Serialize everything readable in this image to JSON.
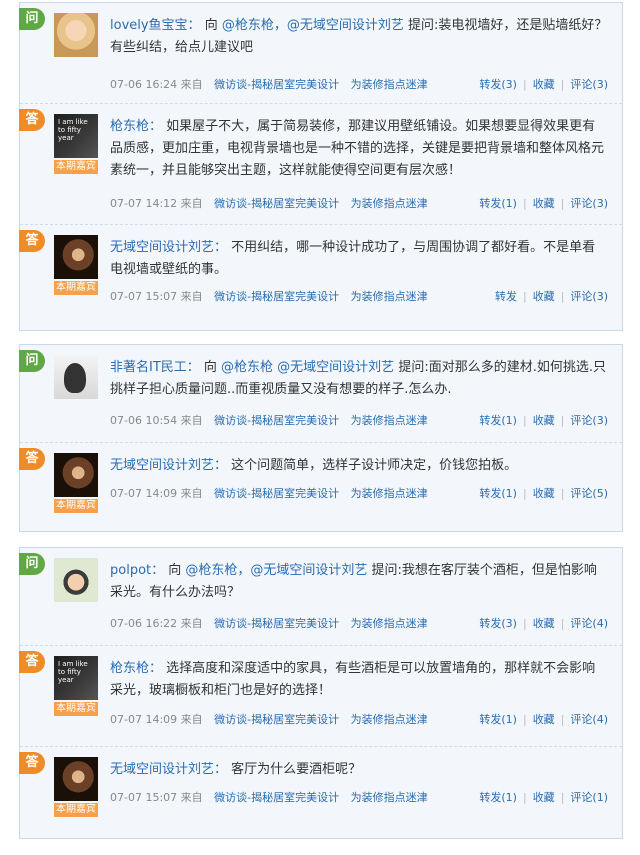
{
  "threads": [
    {
      "question": {
        "badge": "问",
        "avatar": "doll-avatar",
        "name": "lovely鱼宝宝：",
        "prefix": " 向 ",
        "mentions": "@枪东枪，@无域空间设计刘艺",
        "body": " 提问:装电视墙好，还是贴墙纸好？有些纠结，给点儿建议吧",
        "time": "07-06 16:24",
        "from": "来自",
        "source1": "微访谈-揭秘居室完美设计",
        "source2": "为装修指点迷津",
        "forward": "转发(3)",
        "favorite": "收藏",
        "comment": "评论(3)"
      },
      "answers": [
        {
          "badge": "答",
          "avatar": "glasses-avatar",
          "guest": "本期嘉宾",
          "name": "枪东枪：",
          "body": " 如果屋子不大，属于简易装修，那建议用壁纸铺设。如果想要显得效果更有品质感，更加庄重，电视背景墙也是一种不错的选择，关键是要把背景墙和整体风格元素统一，并且能够突出主题，这样就能使得空间更有层次感！",
          "time": "07-07 14:12",
          "from": "来自",
          "source1": "微访谈-揭秘居室完美设计",
          "source2": "为装修指点迷津",
          "forward": "转发(1)",
          "favorite": "收藏",
          "comment": "评论(3)"
        },
        {
          "badge": "答",
          "avatar": "dark-avatar",
          "guest": "本期嘉宾",
          "name": "无域空间设计刘艺：",
          "body": " 不用纠结，哪一种设计成功了，与周围协调了都好看。不是单看电视墙或壁纸的事。",
          "time": "07-07 15:07",
          "from": "来自",
          "source1": "微访谈-揭秘居室完美设计",
          "source2": "为装修指点迷津",
          "forward": "转发",
          "favorite": "收藏",
          "comment": "评论(3)"
        }
      ]
    },
    {
      "question": {
        "badge": "问",
        "avatar": "silhouette-avatar",
        "name": "非著名IT民工：",
        "prefix": " 向 ",
        "mentions": "@枪东枪 @无域空间设计刘艺",
        "body": " 提问:面对那么多的建材.如何挑选.只挑样子担心质量问题..而重视质量又没有想要的样子.怎么办.",
        "time": "07-06 10:54",
        "from": "来自",
        "source1": "微访谈-揭秘居室完美设计",
        "source2": "为装修指点迷津",
        "forward": "转发(1)",
        "favorite": "收藏",
        "comment": "评论(3)"
      },
      "answers": [
        {
          "badge": "答",
          "avatar": "dark-avatar",
          "guest": "本期嘉宾",
          "name": "无域空间设计刘艺：",
          "body": " 这个问题简单，选样子设计师决定，价钱您拍板。",
          "time": "07-07 14:09",
          "from": "来自",
          "source1": "微访谈-揭秘居室完美设计",
          "source2": "为装修指点迷津",
          "forward": "转发(1)",
          "favorite": "收藏",
          "comment": "评论(5)"
        }
      ]
    },
    {
      "question": {
        "badge": "问",
        "avatar": "kid-avatar",
        "name": "polpot：",
        "prefix": " 向 ",
        "mentions": "@枪东枪，@无域空间设计刘艺",
        "body": " 提问:我想在客厅装个酒柜，但是怕影响采光。有什么办法吗？",
        "time": "07-06 16:22",
        "from": "来自",
        "source1": "微访谈-揭秘居室完美设计",
        "source2": "为装修指点迷津",
        "forward": "转发(3)",
        "favorite": "收藏",
        "comment": "评论(4)"
      },
      "answers": [
        {
          "badge": "答",
          "avatar": "glasses-avatar",
          "guest": "本期嘉宾",
          "name": "枪东枪：",
          "body": " 选择高度和深度适中的家具，有些酒柜是可以放置墙角的，那样就不会影响采光，玻璃橱板和柜门也是好的选择！",
          "time": "07-07 14:09",
          "from": "来自",
          "source1": "微访谈-揭秘居室完美设计",
          "source2": "为装修指点迷津",
          "forward": "转发(1)",
          "favorite": "收藏",
          "comment": "评论(4)"
        },
        {
          "badge": "答",
          "avatar": "dark-avatar",
          "guest": "本期嘉宾",
          "name": "无域空间设计刘艺：",
          "body": " 客厅为什么要酒柜呢？",
          "time": "07-07 15:07",
          "from": "来自",
          "source1": "微访谈-揭秘居室完美设计",
          "source2": "为装修指点迷津",
          "forward": "转发(1)",
          "favorite": "收藏",
          "comment": "评论(1)"
        }
      ]
    }
  ],
  "avatar_caption": "I am like to fifty year",
  "colors": {
    "question_badge": "#5fa844",
    "answer_badge": "#f08c28",
    "link": "#2a6cb0",
    "border": "#c9d9ea",
    "panel": "#f3f7fc"
  }
}
